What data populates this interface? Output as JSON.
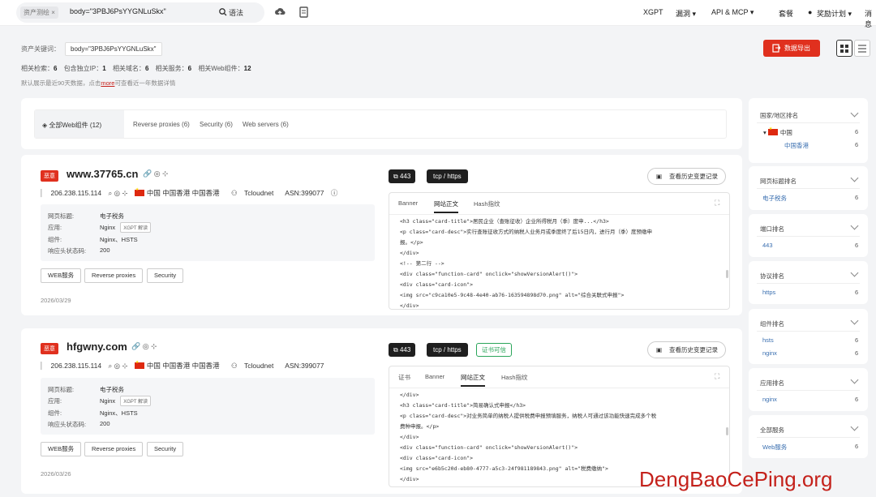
{
  "topbar": {
    "search_tag": "资产测绘 ×",
    "query": "body=\"3PBJ6PsYYGNLuSkx\"",
    "syntax_label": "语法",
    "nav": [
      "XGPT",
      "漏洞 ▾",
      "API & MCP ▾",
      "套餐",
      "奖励计划 ▾",
      "消息"
    ]
  },
  "summary": {
    "keyword_label": "资产关键词：",
    "keyword_value": "body=\"3PBJ6PsYYGNLuSkx\"",
    "stats": [
      {
        "label": "相关检索：",
        "value": "6"
      },
      {
        "label": "包含独立IP：",
        "value": "1"
      },
      {
        "label": "相关域名：",
        "value": "6"
      },
      {
        "label": "相关服务：",
        "value": "6"
      },
      {
        "label": "相关Web组件：",
        "value": "12"
      }
    ],
    "note_prefix": "默认展示最近90天数据，点击",
    "note_link": "more",
    "note_suffix": "可查看近一年数据详情",
    "export_label": "数据导出"
  },
  "filter_tabs": [
    "全部Web组件 (12)",
    "Reverse proxies (6)",
    "Security (6)",
    "Web servers (6)"
  ],
  "results": [
    {
      "badge": "恶意",
      "host": "www.37765.cn",
      "ip": "206.238.115.114",
      "location": "中国 中国香港 中国香港",
      "org": "Tcloudnet",
      "asn": "ASN:399077",
      "title_label": "网页标题:",
      "title_value": "电子税务",
      "app_label": "应用:",
      "app_value": "Nginx",
      "xgpt_label": "XGPT 解读",
      "comp_label": "组件:",
      "comp_value": "Nginx、HSTS",
      "status_label": "响应头状态码:",
      "status_value": "200",
      "chips": [
        "WEB服务",
        "Reverse proxies",
        "Security"
      ],
      "date": "2026/03/29",
      "port": "443",
      "proto": "tcp / https",
      "cert": "",
      "history_label": "查看历史变更记录",
      "code_tabs": [
        "Banner",
        "网站正文",
        "Hash指纹"
      ],
      "code_lines": [
        "    <h3 class=\"card-title\">居民企业（查账征收）企业所得税月（季）度申...</h3>",
        "    <p class=\"card-desc\">实行查账征收方式的纳税人业务月或季度终了后15日内，进行月（季）度预缴申",
        "报。</p>",
        "  </div>",
        "  <!-- 第二行 -->",
        "  <div class=\"function-card\" onclick=\"showVersionAlert()\">",
        "    <div class=\"card-icon\">",
        "      <img src=\"c9ca10e5-9c48-4e40-ab76-163594898d70.png\" alt=\"综合关联式申报\">",
        "    </div>"
      ]
    },
    {
      "badge": "恶意",
      "host": "hfgwny.com",
      "ip": "206.238.115.114",
      "location": "中国 中国香港 中国香港",
      "org": "Tcloudnet",
      "asn": "ASN:399077",
      "title_label": "网页标题:",
      "title_value": "电子税务",
      "app_label": "应用:",
      "app_value": "Nginx",
      "xgpt_label": "XGPT 解读",
      "comp_label": "组件:",
      "comp_value": "Nginx、HSTS",
      "status_label": "响应头状态码:",
      "status_value": "200",
      "chips": [
        "WEB服务",
        "Reverse proxies",
        "Security"
      ],
      "date": "2026/03/26",
      "port": "443",
      "proto": "tcp / https",
      "cert": "证书可信",
      "history_label": "查看历史变更记录",
      "code_tabs": [
        "证书",
        "Banner",
        "网站正文",
        "Hash指纹"
      ],
      "code_lines": [
        "    </div>",
        "    <h3 class=\"card-title\">简易确认式申报</h3>",
        "    <p class=\"card-desc\">对业务简单的纳税人提供税费申报预填服务，纳税人可通过该功能快速完成多个税",
        "费种申报。</p>",
        "  </div>",
        "  <div class=\"function-card\" onclick=\"showVersionAlert()\">",
        "    <div class=\"card-icon\">",
        "      <img src=\"e6b5c20d-eb80-4777-a5c3-24f981189843.png\" alt=\"税费缴纳\">",
        "    </div>"
      ]
    }
  ],
  "sidebar": [
    {
      "title": "国家/地区排名",
      "items": [
        {
          "label": "中国",
          "count": "6"
        },
        {
          "label": "中国香港",
          "count": "6"
        }
      ]
    },
    {
      "title": "网页标题排名",
      "items": [
        {
          "label": "电子税务",
          "count": "6"
        }
      ]
    },
    {
      "title": "端口排名",
      "items": [
        {
          "label": "443",
          "count": "6"
        }
      ]
    },
    {
      "title": "协议排名",
      "items": [
        {
          "label": "https",
          "count": "6"
        }
      ]
    },
    {
      "title": "组件排名",
      "items": [
        {
          "label": "hsts",
          "count": "6"
        },
        {
          "label": "nginx",
          "count": "6"
        }
      ]
    },
    {
      "title": "应用排名",
      "items": [
        {
          "label": "nginx",
          "count": "6"
        }
      ]
    },
    {
      "title": "全部服务",
      "items": [
        {
          "label": "Web服务",
          "count": "6"
        }
      ]
    }
  ],
  "watermark": "DengBaoCePing.org",
  "colors": {
    "accent": "#e0301e",
    "link": "#3a6fb0",
    "cert": "#2aa55a"
  }
}
